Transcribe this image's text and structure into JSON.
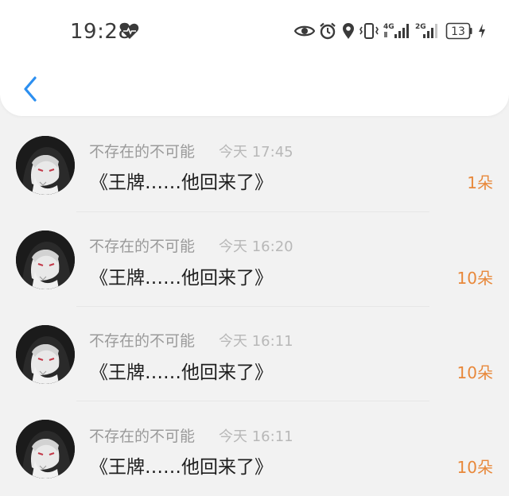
{
  "status_bar": {
    "time": "19:28",
    "network_4g": "4G",
    "network_2g": "2G",
    "battery_level": "13"
  },
  "colors": {
    "accent_blue": "#2c8ff0",
    "count_orange": "#e8883a",
    "name_gray": "#9a9a9a",
    "title_dark": "#1e1e1e"
  },
  "items": [
    {
      "name": "不存在的不可能",
      "time": "今天 17:45",
      "title": "《王牌……他回来了》",
      "count": "1朵"
    },
    {
      "name": "不存在的不可能",
      "time": "今天 16:20",
      "title": "《王牌……他回来了》",
      "count": "10朵"
    },
    {
      "name": "不存在的不可能",
      "time": "今天 16:11",
      "title": "《王牌……他回来了》",
      "count": "10朵"
    },
    {
      "name": "不存在的不可能",
      "time": "今天 16:11",
      "title": "《王牌……他回来了》",
      "count": "10朵"
    }
  ]
}
